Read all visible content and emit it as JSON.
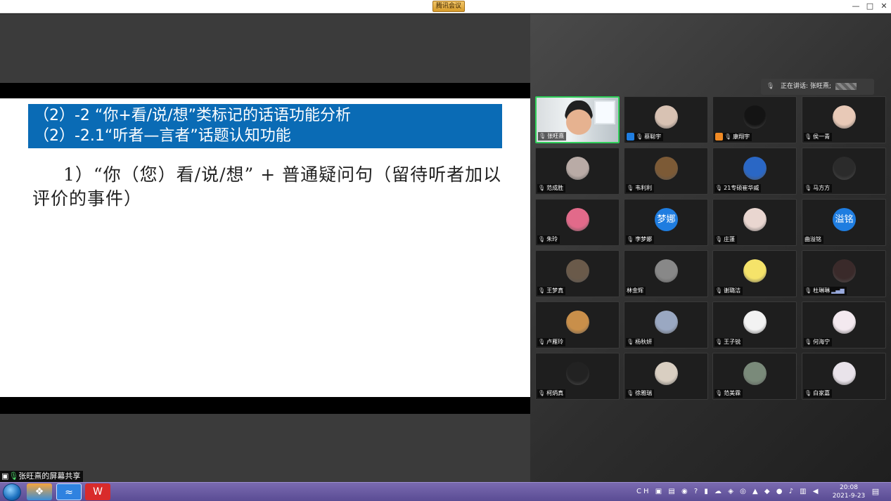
{
  "window": {
    "title": "腾讯会议",
    "minimize_icon": "—",
    "maximize_icon": "□",
    "close_icon": "✕"
  },
  "slide": {
    "header_line1": "（2）-2 “你+看/说/想”类标记的话语功能分析",
    "header_line2": "（2）-2.1“听者—言者”话题认知功能",
    "body": "1）“你（您）看/说/想” + 普通疑问句（留待听者加以评价的事件）"
  },
  "sharer": {
    "label": "张旺熹的屏幕共享"
  },
  "speaker": {
    "prefix": "正在讲话: 张旺熹;"
  },
  "participants": [
    {
      "name": "张旺熹",
      "active": true,
      "icon": "mic-icon"
    },
    {
      "name": "蔡聪宇",
      "icon": "mic-icon",
      "badge": "user-blue"
    },
    {
      "name": "康翔宇",
      "icon": "mic-icon",
      "badge": "user-orange"
    },
    {
      "name": "侯一青",
      "icon": "mic-icon"
    },
    {
      "name": "范成胜",
      "icon": "mic-icon"
    },
    {
      "name": "韦利利",
      "icon": "mic-icon"
    },
    {
      "name": "21专硕崔华威",
      "icon": "mic-icon"
    },
    {
      "name": "马方方",
      "icon": "mic-icon"
    },
    {
      "name": "朱玲",
      "icon": "mic-icon"
    },
    {
      "name": "李梦娜",
      "icon": "mic-icon",
      "avatar_text": "梦娜"
    },
    {
      "name": "庄蓬",
      "icon": "mic-icon"
    },
    {
      "name": "曲溢铭",
      "icon": "none",
      "avatar_text": "溢铭"
    },
    {
      "name": "王梦真",
      "icon": "mic-icon"
    },
    {
      "name": "林金辉",
      "icon": "none"
    },
    {
      "name": "谢璐洁",
      "icon": "mic-icon"
    },
    {
      "name": "杜琳琳",
      "icon": "mic-icon",
      "signal": true
    },
    {
      "name": "卢雁玲",
      "icon": "mic-icon"
    },
    {
      "name": "杨秋妍",
      "icon": "mic-icon"
    },
    {
      "name": "王子锐",
      "icon": "mic-icon"
    },
    {
      "name": "何海宁",
      "icon": "mic-icon"
    },
    {
      "name": "柯炳真",
      "icon": "mic-icon"
    },
    {
      "name": "徐雅瑞",
      "icon": "mic-icon"
    },
    {
      "name": "范美霖",
      "icon": "mic-icon"
    },
    {
      "name": "白家嘉",
      "icon": "mic-icon"
    }
  ],
  "taskbar": {
    "tray_text": "CH",
    "time": "20:08",
    "date": "2021-9-23"
  },
  "colors": {
    "slide_header_bg": "#0a6bb5",
    "active_border": "#2fcf5a",
    "avatar_text_bg": "#1f7de0"
  }
}
